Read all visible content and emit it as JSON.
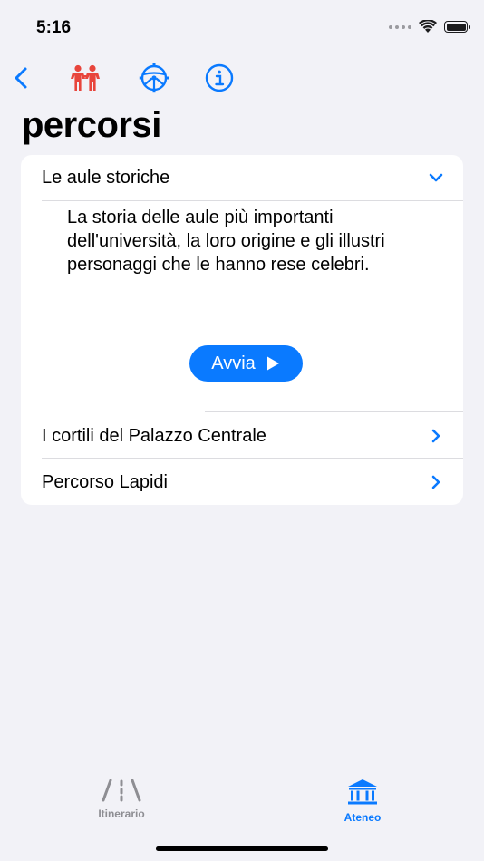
{
  "status_bar": {
    "time": "5:16"
  },
  "nav": {
    "back_icon": "chevron-left-icon",
    "people_icon": "people-icon",
    "settings_icon": "steering-wheel-icon",
    "info_icon": "info-icon",
    "accent_color": "#0a7aff",
    "people_color": "#e8453c"
  },
  "page": {
    "title": "percorsi"
  },
  "routes": [
    {
      "label": "Le aule storiche",
      "expanded": true,
      "description": "La storia delle aule più importanti dell'università, la loro origine e gli illustri personaggi che le hanno rese celebri.",
      "start_label": "Avvia"
    },
    {
      "label": "I cortili del Palazzo Centrale",
      "expanded": false
    },
    {
      "label": "Percorso Lapidi",
      "expanded": false
    }
  ],
  "tab_bar": {
    "tabs": [
      {
        "label": "Itinerario",
        "icon": "road-icon",
        "selected": false
      },
      {
        "label": "Ateneo",
        "icon": "university-building-icon",
        "selected": true
      }
    ]
  }
}
